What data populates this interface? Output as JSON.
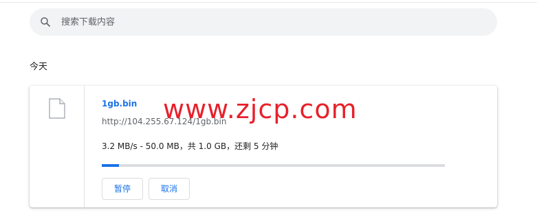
{
  "search": {
    "placeholder": "搜索下载内容",
    "value": "",
    "icon": "search-icon"
  },
  "section": {
    "heading": "今天"
  },
  "download": {
    "file_name": "1gb.bin",
    "url": "http://104.255.67.124/1gb.bin",
    "status": "3.2 MB/s - 50.0 MB，共 1.0 GB，还剩 5 分钟",
    "progress_percent": 5,
    "file_icon": "file-icon",
    "buttons": {
      "pause_label": "暂停",
      "cancel_label": "取消"
    }
  },
  "watermark": {
    "text": "www.zjcp.com"
  },
  "colors": {
    "accent": "#1a73e8",
    "search_bg": "#f1f3f4",
    "watermark": "#e8202a",
    "progress_track": "#dadce0"
  }
}
